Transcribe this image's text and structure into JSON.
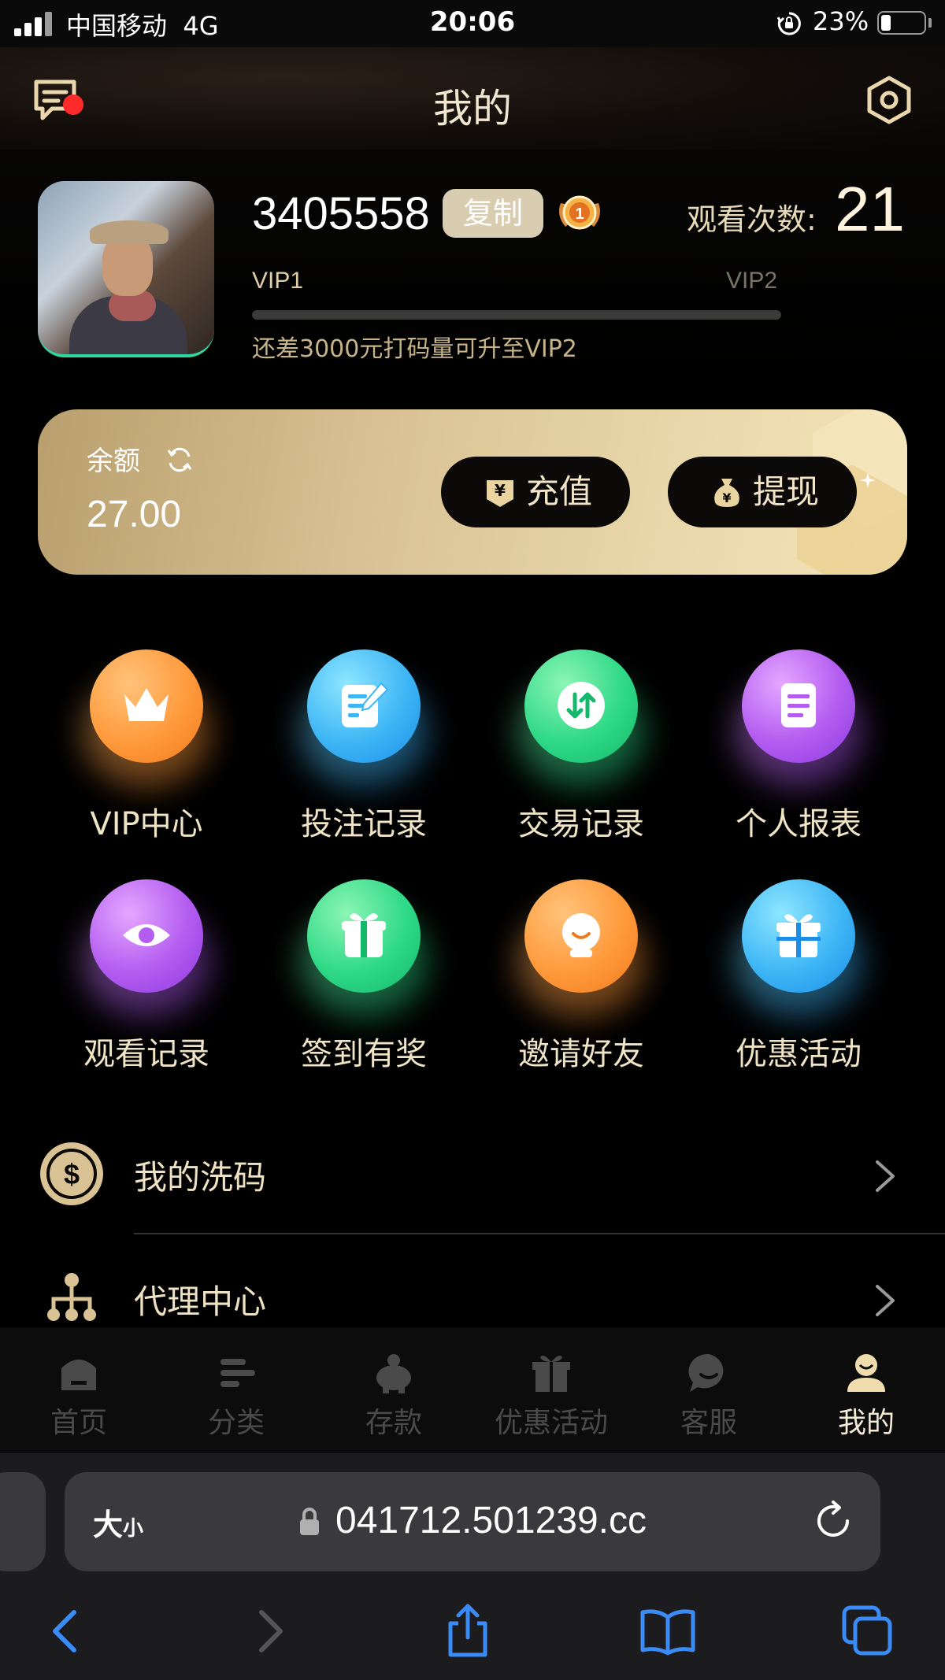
{
  "status_bar": {
    "carrier": "中国移动",
    "network": "4G",
    "time": "20:06",
    "battery_percent": "23%",
    "battery_level": 0.23
  },
  "header": {
    "title": "我的"
  },
  "profile": {
    "user_id": "3405558",
    "copy_label": "复制",
    "medal_number": "1",
    "view_count_label": "观看次数:",
    "view_count": "21",
    "vip_current": "VIP1",
    "vip_next": "VIP2",
    "vip_progress": 0,
    "vip_hint": "还差3000元打码量可升至VIP2"
  },
  "balance": {
    "label": "余额",
    "value": "27.00",
    "recharge_label": "充值",
    "withdraw_label": "提现"
  },
  "grid": [
    {
      "label": "VIP中心",
      "icon": "crown-icon",
      "color": "orange"
    },
    {
      "label": "投注记录",
      "icon": "edit-note-icon",
      "color": "blue"
    },
    {
      "label": "交易记录",
      "icon": "transfer-arrows-icon",
      "color": "green"
    },
    {
      "label": "个人报表",
      "icon": "document-icon",
      "color": "purple"
    },
    {
      "label": "观看记录",
      "icon": "eye-icon",
      "color": "purple"
    },
    {
      "label": "签到有奖",
      "icon": "gift-box-icon",
      "color": "green"
    },
    {
      "label": "邀请好友",
      "icon": "friend-face-icon",
      "color": "orange"
    },
    {
      "label": "优惠活动",
      "icon": "gift-icon",
      "color": "blue"
    }
  ],
  "list": [
    {
      "label": "我的洗码",
      "icon": "dollar-coin-icon"
    },
    {
      "label": "代理中心",
      "icon": "org-tree-icon"
    }
  ],
  "bottom_nav": [
    {
      "label": "首页",
      "icon": "home-icon",
      "active": false
    },
    {
      "label": "分类",
      "icon": "category-icon",
      "active": false
    },
    {
      "label": "存款",
      "icon": "piggy-bank-icon",
      "active": false
    },
    {
      "label": "优惠活动",
      "icon": "gift-icon",
      "active": false
    },
    {
      "label": "客服",
      "icon": "chat-bubble-icon",
      "active": false
    },
    {
      "label": "我的",
      "icon": "user-icon",
      "active": true
    }
  ],
  "browser": {
    "font_size_label": "大",
    "font_size_small": "小",
    "url": "041712.501239.cc"
  },
  "colors": {
    "accent_gold": "#d9c394",
    "notification_red": "#ff2b2b",
    "browser_blue": "#3a8bf5"
  }
}
